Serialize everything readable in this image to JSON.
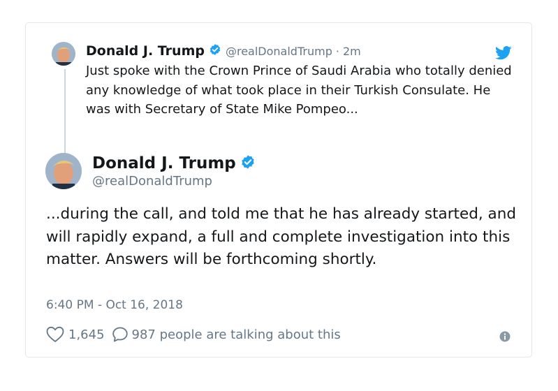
{
  "colors": {
    "text": "#14171a",
    "secondary": "#657786",
    "twitter_blue": "#1da1f2",
    "border": "#e1e8ed"
  },
  "parent_tweet": {
    "avatar": "avatar-image",
    "name": "Donald J. Trump",
    "verified_icon": "verified-badge-icon",
    "handle": "@realDonaldTrump",
    "separator": "·",
    "time": "2m",
    "text": "Just spoke with the Crown Prince of Saudi Arabia who totally denied any knowledge of what took place in their Turkish Consulate. He was with Secretary of State Mike Pompeo..."
  },
  "brand_icon": "twitter-bird-icon",
  "main_tweet": {
    "avatar": "avatar-image",
    "name": "Donald J. Trump",
    "verified_icon": "verified-badge-icon",
    "handle": "@realDonaldTrump",
    "text": "...during the call, and told me that he has already started, and will rapidly expand, a full and complete investigation into this matter. Answers will be forthcoming shortly.",
    "timestamp": "6:40 PM - Oct 16, 2018"
  },
  "actions": {
    "like_icon": "heart-icon",
    "like_count": "1,645",
    "reply_icon": "speech-bubble-icon",
    "talking_text": "987 people are talking about this",
    "info_icon": "info-icon"
  }
}
